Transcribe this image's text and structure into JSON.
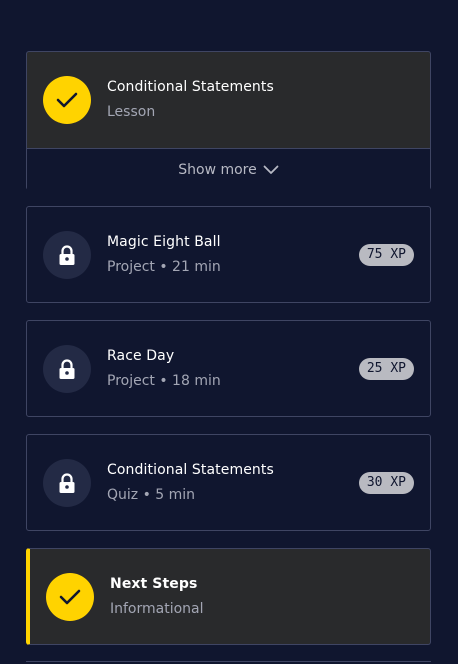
{
  "items": [
    {
      "title": "Conditional Statements",
      "subtitle": "Lesson",
      "status": "complete"
    },
    {
      "title": "Magic Eight Ball",
      "subtitle": "Project • 21 min",
      "xp": "75 XP",
      "status": "locked"
    },
    {
      "title": "Race Day",
      "subtitle": "Project • 18 min",
      "xp": "25 XP",
      "status": "locked"
    },
    {
      "title": "Conditional Statements",
      "subtitle": "Quiz • 5 min",
      "xp": "30 XP",
      "status": "locked"
    },
    {
      "title": "Next Steps",
      "subtitle": "Informational",
      "status": "complete"
    }
  ],
  "show_more_label": "Show more",
  "colors": {
    "background": "#10162f",
    "accent": "#ffd300",
    "card_done": "#292a2c",
    "border": "#3f4563"
  }
}
